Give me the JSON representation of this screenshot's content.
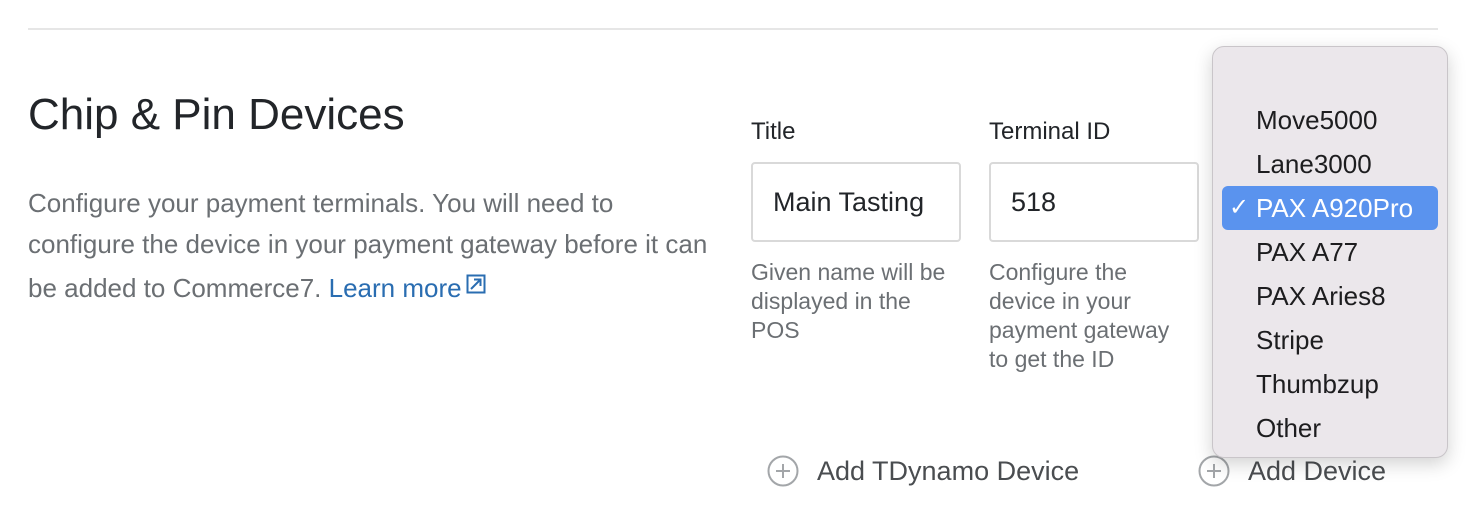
{
  "section": {
    "title": "Chip & Pin Devices",
    "description": "Configure your payment terminals. You will need to configure the device in your payment gateway before it can be added to Commerce7.",
    "learn_more": "Learn more"
  },
  "fields": {
    "title": {
      "label": "Title",
      "value": "Main Tasting",
      "help": "Given name will be displayed in the POS"
    },
    "terminal_id": {
      "label": "Terminal ID",
      "value": "518",
      "help": "Configure the device in your payment gateway to get the ID"
    }
  },
  "device_type_menu": {
    "options": [
      "Move5000",
      "Lane3000",
      "PAX A920Pro",
      "PAX A77",
      "PAX Aries8",
      "Stripe",
      "Thumbzup",
      "Other"
    ],
    "selected": "PAX A920Pro",
    "check_glyph": "✓"
  },
  "actions": {
    "add_tdynamo_device": "Add TDynamo Device",
    "add_device": "Add Device"
  },
  "colors": {
    "link": "#2a6db1",
    "selected_option": "#5a93ee",
    "menu_background": "#ebe7eb"
  }
}
